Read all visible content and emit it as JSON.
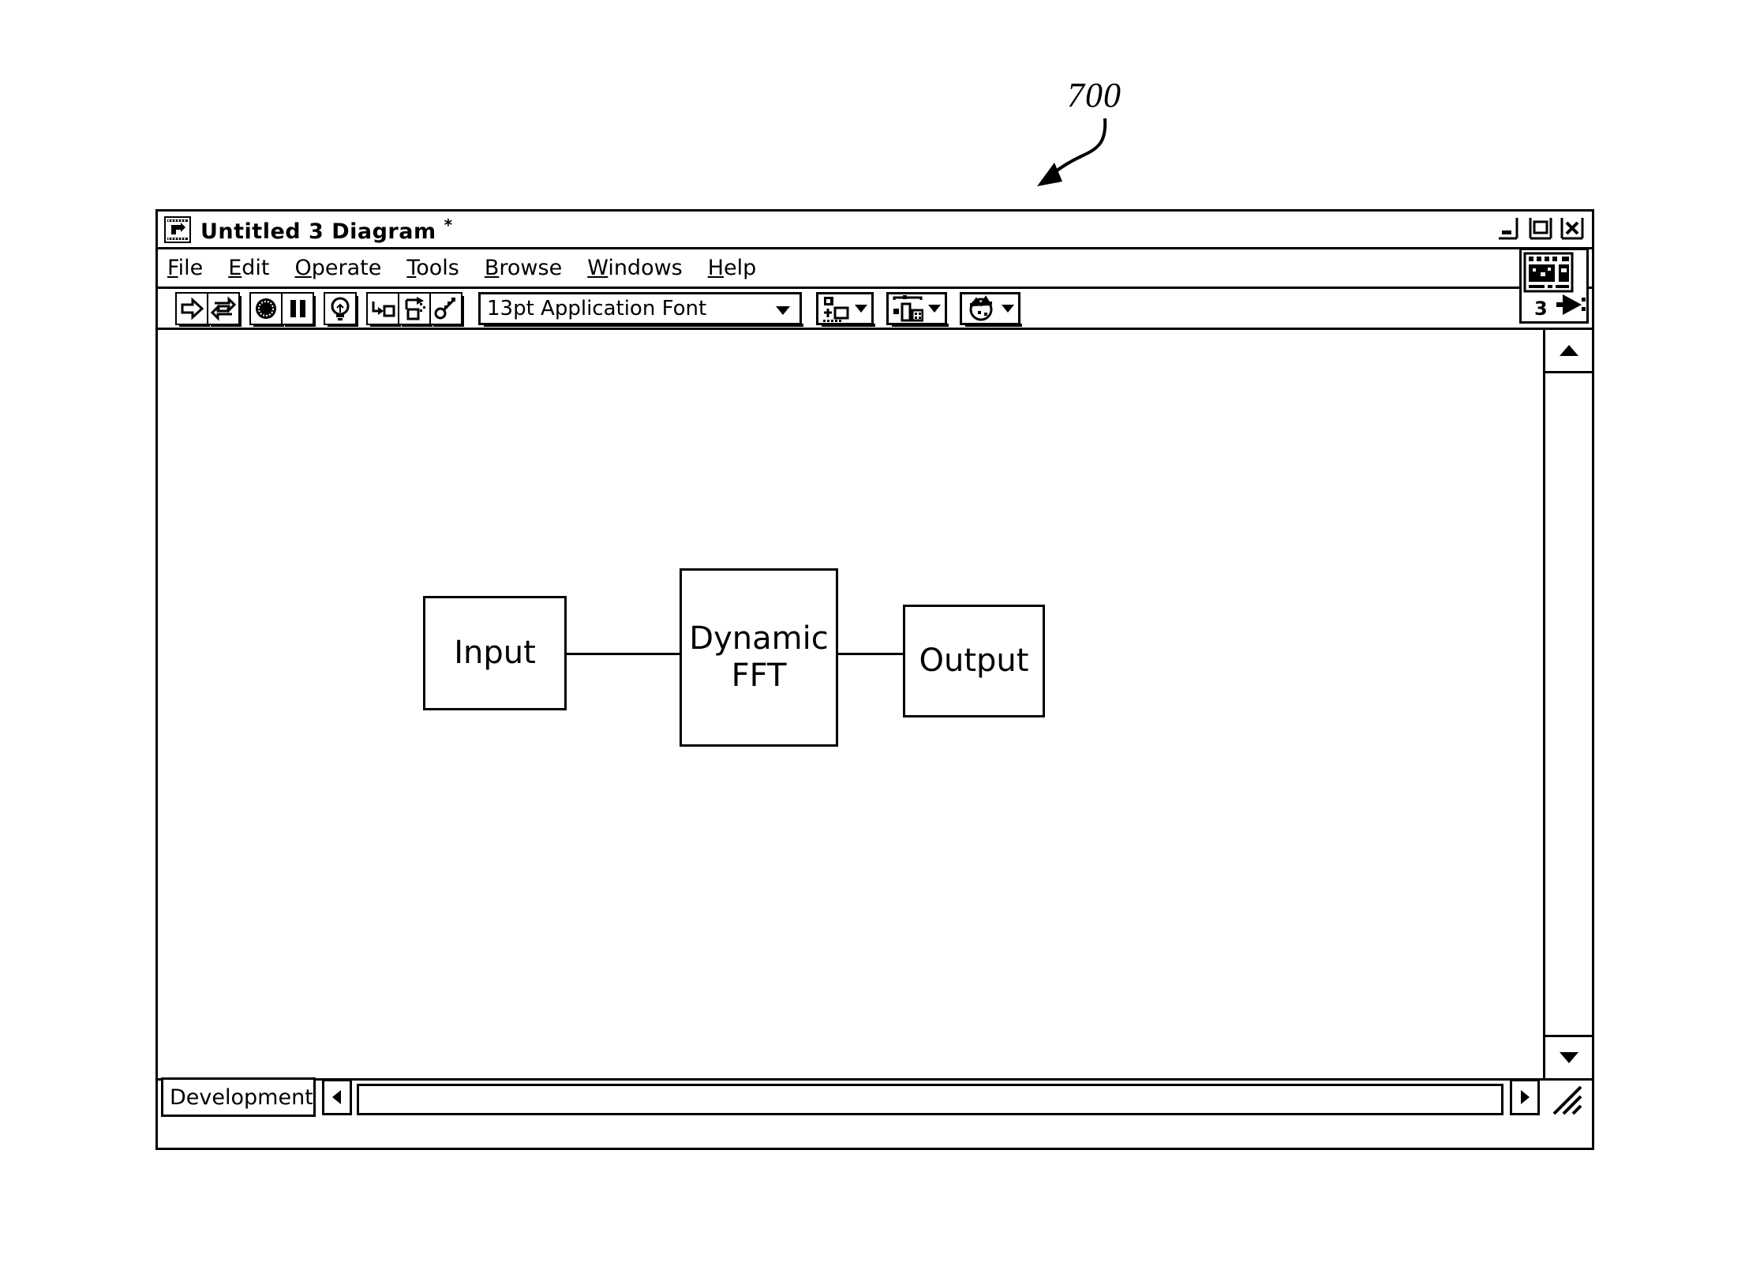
{
  "figure": {
    "reference_numeral": "700"
  },
  "window": {
    "title": "Untitled 3 Diagram",
    "dirty_marker": "*",
    "icon": "labview-vi-icon",
    "controls": [
      {
        "name": "minimize-button",
        "icon": "minimize-icon",
        "label": "_"
      },
      {
        "name": "maximize-button",
        "icon": "maximize-icon",
        "label": "□"
      },
      {
        "name": "close-button",
        "icon": "close-icon",
        "label": "X"
      }
    ]
  },
  "menubar": {
    "items": [
      {
        "name": "menu-file",
        "acc": "F",
        "rest": "ile"
      },
      {
        "name": "menu-edit",
        "acc": "E",
        "rest": "dit"
      },
      {
        "name": "menu-operate",
        "acc": "O",
        "rest": "perate"
      },
      {
        "name": "menu-tools",
        "acc": "T",
        "rest": "ools"
      },
      {
        "name": "menu-browse",
        "acc": "B",
        "rest": "rowse"
      },
      {
        "name": "menu-windows",
        "acc": "W",
        "rest": "indows"
      },
      {
        "name": "menu-help",
        "acc": "H",
        "rest": "elp"
      }
    ],
    "connector_pane_icon": "vi-connector-pane-icon",
    "connector_pane_number": "3"
  },
  "toolbar": {
    "buttons": [
      {
        "name": "run-button",
        "icon": "run-arrow-icon",
        "tooltip": "Run"
      },
      {
        "name": "run-continuously-button",
        "icon": "run-continuously-icon",
        "tooltip": "Run Continuously"
      },
      {
        "name": "abort-execution-button",
        "icon": "abort-stop-icon",
        "tooltip": "Abort Execution"
      },
      {
        "name": "pause-button",
        "icon": "pause-icon",
        "tooltip": "Pause"
      },
      {
        "name": "highlight-execution-button",
        "icon": "lightbulb-icon",
        "tooltip": "Highlight Execution"
      },
      {
        "name": "step-into-button",
        "icon": "step-into-icon",
        "tooltip": "Step Into"
      },
      {
        "name": "step-over-button",
        "icon": "step-over-icon",
        "tooltip": "Step Over"
      },
      {
        "name": "step-out-button",
        "icon": "step-out-icon",
        "tooltip": "Step Out"
      }
    ],
    "font_select": {
      "value": "13pt Application Font",
      "icon": "chevron-down-icon"
    },
    "dropdowns": [
      {
        "name": "align-objects-button",
        "icon": "align-objects-icon"
      },
      {
        "name": "distribute-objects-button",
        "icon": "distribute-objects-icon"
      },
      {
        "name": "reorder-button",
        "icon": "reorder-icon"
      }
    ]
  },
  "diagram": {
    "nodes": [
      {
        "name": "node-input",
        "label": "Input"
      },
      {
        "name": "node-dynamic-fft",
        "label_line1": "Dynamic",
        "label_line2": "FFT"
      },
      {
        "name": "node-output",
        "label": "Output"
      }
    ],
    "wires": [
      {
        "name": "wire-input-to-fft",
        "from": "Input",
        "to": "Dynamic FFT"
      },
      {
        "name": "wire-fft-to-output",
        "from": "Dynamic FFT",
        "to": "Output"
      }
    ]
  },
  "scrollbars": {
    "vertical": {
      "up_icon": "scroll-up-arrow-icon",
      "down_icon": "scroll-down-arrow-icon"
    },
    "horizontal": {
      "left_icon": "scroll-left-arrow-icon",
      "right_icon": "scroll-right-arrow-icon"
    }
  },
  "statusbar": {
    "tab_label": "Development",
    "tab_arrow_icon": "scroll-left-arrow-icon",
    "resize_grip_icon": "resize-grip-icon"
  }
}
